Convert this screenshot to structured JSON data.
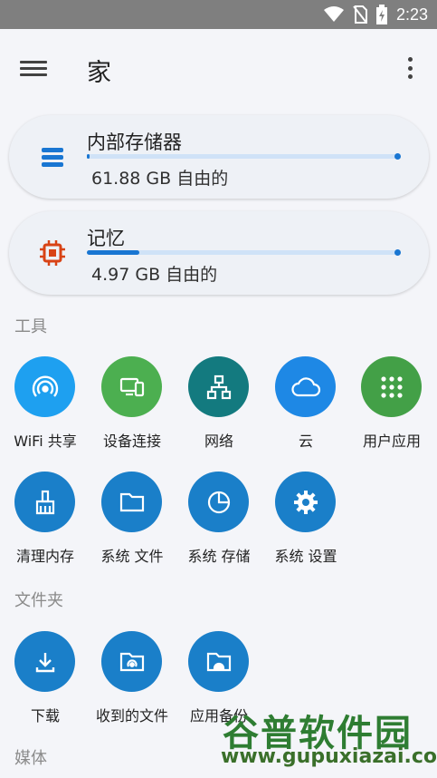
{
  "status_bar": {
    "time": "2:23",
    "icons": [
      "wifi-icon",
      "no-sim-icon",
      "battery-charging-icon"
    ]
  },
  "app_bar": {
    "title": "家",
    "menu_icon": "hamburger-menu-icon",
    "more_icon": "more-vert-icon"
  },
  "storage": [
    {
      "title": "内部存储器",
      "subtitle": "61.88 GB 自由的",
      "icon": "storage-stack-icon",
      "used_fraction": 0.01
    },
    {
      "title": "记忆",
      "subtitle": "4.97 GB 自由的",
      "icon": "memory-chip-icon",
      "used_fraction": 0.17
    }
  ],
  "sections": {
    "tools": "工具",
    "folders": "文件夹",
    "media": "媒体"
  },
  "tools": [
    {
      "label": "WiFi 共享",
      "icon": "wifi-share-icon",
      "color": "#1ea0f0"
    },
    {
      "label": "设备连接",
      "icon": "device-connect-icon",
      "color": "#4caf50"
    },
    {
      "label": "网络",
      "icon": "network-icon",
      "color": "#137a7f"
    },
    {
      "label": "云",
      "icon": "cloud-icon",
      "color": "#1e88e5"
    },
    {
      "label": "用户应用",
      "icon": "apps-grid-icon",
      "color": "#43a047"
    },
    {
      "label": "清理内存",
      "icon": "broom-icon",
      "color": "#1a7fc9"
    },
    {
      "label": "系统 文件",
      "icon": "folder-icon",
      "color": "#1a7fc9"
    },
    {
      "label": "系统 存储",
      "icon": "pie-chart-icon",
      "color": "#1a7fc9"
    },
    {
      "label": "系统 设置",
      "icon": "settings-gear-icon",
      "color": "#1a7fc9"
    }
  ],
  "folders": [
    {
      "label": "下载",
      "icon": "download-icon",
      "color": "#1a7fc9"
    },
    {
      "label": "收到的文件",
      "icon": "received-files-icon",
      "color": "#1a7fc9"
    },
    {
      "label": "应用备份",
      "icon": "app-backup-icon",
      "color": "#1a7fc9"
    }
  ],
  "watermark": {
    "text": "谷普软件园",
    "url": "www.gupuxiazai.com"
  }
}
